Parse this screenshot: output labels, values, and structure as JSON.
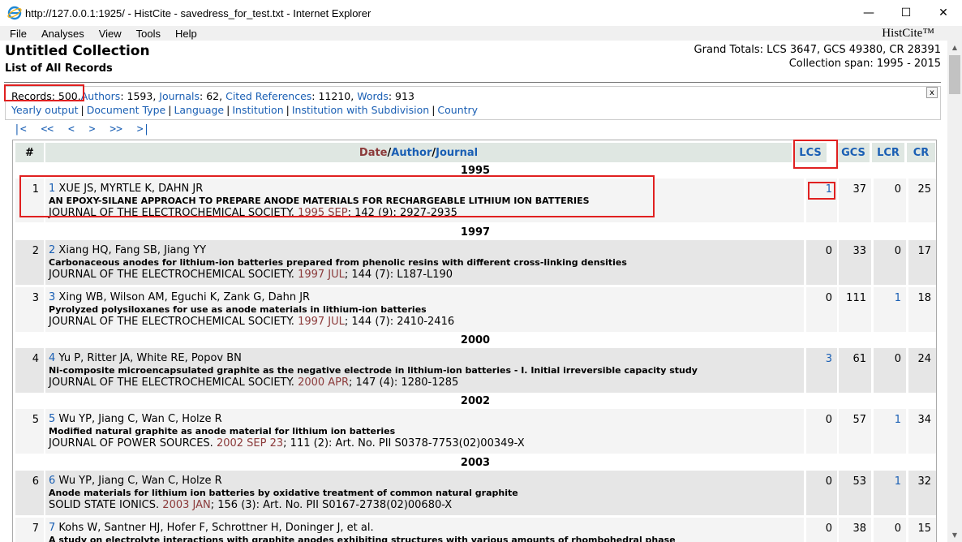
{
  "window": {
    "title": "http://127.0.0.1:1925/ - HistCite - savedress_for_test.txt - Internet Explorer",
    "minimize": "—",
    "maximize": "☐",
    "close": "✕"
  },
  "menu": [
    "File",
    "Analyses",
    "View",
    "Tools",
    "Help"
  ],
  "brand": "HistCite™",
  "header": {
    "title": "Untitled Collection",
    "subtitle": "List of All Records",
    "totals": "Grand Totals: LCS 3647, GCS 49380, CR 28391",
    "span": "Collection span: 1995 - 2015"
  },
  "info": {
    "records_label": "Records: 500,",
    "authors_label": "Authors",
    "authors_count": ": 1593,",
    "journals_label": "Journals",
    "journals_count": ": 62,",
    "cited_label": "Cited References",
    "cited_count": ": 11210,",
    "words_label": "Words",
    "words_count": ": 913",
    "links": [
      "Yearly output",
      "Document Type",
      "Language",
      "Institution",
      "Institution with Subdivision",
      "Country"
    ],
    "close": "x"
  },
  "pager": [
    "|<",
    "<<",
    "<",
    ">",
    ">>",
    ">|"
  ],
  "table": {
    "headers": {
      "num": "#",
      "date": "Date",
      "slash1": " / ",
      "author": "Author",
      "slash2": " / ",
      "journal": "Journal",
      "lcs": "LCS",
      "gcs": "GCS",
      "lcr": "LCR",
      "cr": "CR"
    },
    "years": [
      "1995",
      "1997",
      "2000",
      "2002",
      "2003"
    ],
    "rows": [
      {
        "num": "1",
        "link": "1",
        "authors": "XUE JS, MYRTLE K, DAHN JR",
        "title": "AN EPOXY-SILANE APPROACH TO PREPARE ANODE MATERIALS FOR RECHARGEABLE LITHIUM ION BATTERIES",
        "journal": "JOURNAL OF THE ELECTROCHEMICAL SOCIETY.",
        "date": "1995 SEP",
        "ref": "; 142 (9): 2927-2935",
        "lcs": "1",
        "gcs": "37",
        "lcr": "0",
        "cr": "25"
      },
      {
        "num": "2",
        "link": "2",
        "authors": "Xiang HQ, Fang SB, Jiang YY",
        "title": "Carbonaceous anodes for lithium-ion batteries prepared from phenolic resins with different cross-linking densities",
        "journal": "JOURNAL OF THE ELECTROCHEMICAL SOCIETY.",
        "date": "1997 JUL",
        "ref": "; 144 (7): L187-L190",
        "lcs": "0",
        "gcs": "33",
        "lcr": "0",
        "cr": "17"
      },
      {
        "num": "3",
        "link": "3",
        "authors": "Xing WB, Wilson AM, Eguchi K, Zank G, Dahn JR",
        "title": "Pyrolyzed polysiloxanes for use as anode materials in lithium-ion batteries",
        "journal": "JOURNAL OF THE ELECTROCHEMICAL SOCIETY.",
        "date": "1997 JUL",
        "ref": "; 144 (7): 2410-2416",
        "lcs": "0",
        "gcs": "111",
        "lcr": "1",
        "cr": "18"
      },
      {
        "num": "4",
        "link": "4",
        "authors": "Yu P, Ritter JA, White RE, Popov BN",
        "title": "Ni-composite microencapsulated graphite as the negative electrode in lithium-ion batteries - I. Initial irreversible capacity study",
        "journal": "JOURNAL OF THE ELECTROCHEMICAL SOCIETY.",
        "date": "2000 APR",
        "ref": "; 147 (4): 1280-1285",
        "lcs": "3",
        "gcs": "61",
        "lcr": "0",
        "cr": "24"
      },
      {
        "num": "5",
        "link": "5",
        "authors": "Wu YP, Jiang C, Wan C, Holze R",
        "title": "Modified natural graphite as anode material for lithium ion batteries",
        "journal": "JOURNAL OF POWER SOURCES.",
        "date": "2002 SEP 23",
        "ref": "; 111 (2): Art. No. PII S0378-7753(02)00349-X",
        "lcs": "0",
        "gcs": "57",
        "lcr": "1",
        "cr": "34"
      },
      {
        "num": "6",
        "link": "6",
        "authors": "Wu YP, Jiang C, Wan C, Holze R",
        "title": "Anode materials for lithium ion batteries by oxidative treatment of common natural graphite",
        "journal": "SOLID STATE IONICS.",
        "date": "2003 JAN",
        "ref": "; 156 (3): Art. No. PII S0167-2738(02)00680-X",
        "lcs": "0",
        "gcs": "53",
        "lcr": "1",
        "cr": "32"
      },
      {
        "num": "7",
        "link": "7",
        "authors": "Kohs W, Santner HJ, Hofer F, Schrottner H, Doninger J, et al.",
        "title": "A study on electrolyte interactions with graphite anodes exhibiting structures with various amounts of rhombohedral phase",
        "journal": "",
        "date": "",
        "ref": "",
        "lcs": "0",
        "gcs": "38",
        "lcr": "0",
        "cr": "15"
      }
    ]
  }
}
